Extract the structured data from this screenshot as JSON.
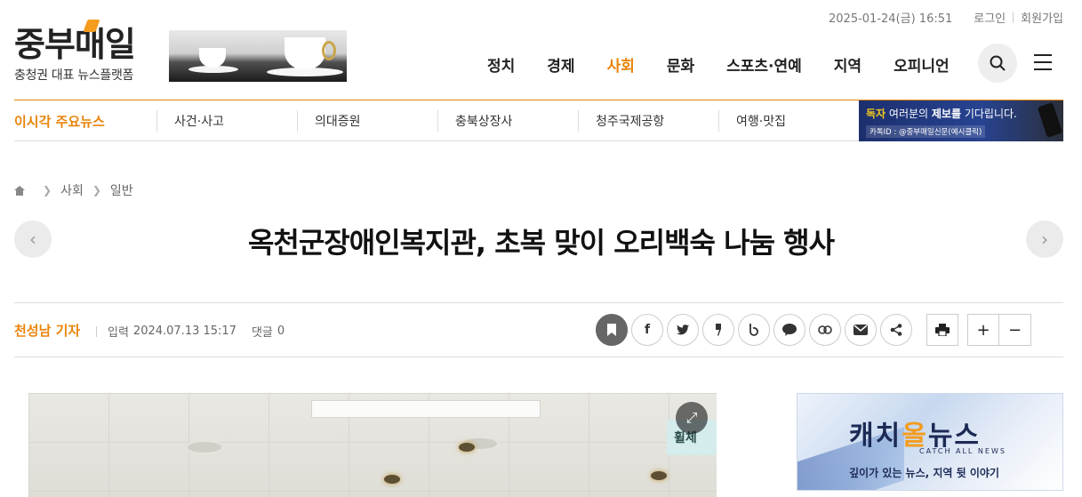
{
  "util": {
    "date": "2025-01-24(금) 16:51",
    "login": "로그인",
    "signup": "회원가입"
  },
  "logo": {
    "name": "중부매일",
    "tagline": "충청권 대표 뉴스플랫폼"
  },
  "nav": {
    "items": [
      "정치",
      "경제",
      "사회",
      "문화",
      "스포츠·연예",
      "지역",
      "오피니언"
    ],
    "active": "사회"
  },
  "subbar": {
    "hot_label": "이시각 주요뉴스",
    "keywords": [
      "사건·사고",
      "의대증원",
      "충북상장사",
      "청주국제공항",
      "여행·맛집"
    ],
    "tip_banner": {
      "line1_prefix": "독자",
      "line1_mid": " 여러분의 ",
      "line1_bold": "제보를",
      "line1_suffix": " 기다립니다.",
      "line2": "카톡ID : @중부매일신문(예시클릭)"
    }
  },
  "breadcrumb": {
    "section": "사회",
    "subsection": "일반"
  },
  "article": {
    "title": "옥천군장애인복지관, 초복 맞이 오리백숙 나눔 행사",
    "writer": "천성남 기자",
    "input_label": "입력",
    "input_date": "2024.07.13 15:17",
    "comment_label": "댓글",
    "comment_count": "0"
  },
  "share_icons": [
    "bookmark-icon",
    "facebook-icon",
    "twitter-icon",
    "kakaostory-icon",
    "band-icon",
    "kakaotalk-icon",
    "link-icon",
    "email-icon",
    "share-icon"
  ],
  "photo": {
    "sign_text": "휠체"
  },
  "side_banner": {
    "title_pre": "캐치",
    "title_o": "올",
    "title_post": "뉴스",
    "english": "CATCH ALL NEWS",
    "slogan": "깊이가 있는 뉴스, 지역 뒷 이야기"
  },
  "colors": {
    "accent": "#e8840a",
    "text": "#222222"
  }
}
